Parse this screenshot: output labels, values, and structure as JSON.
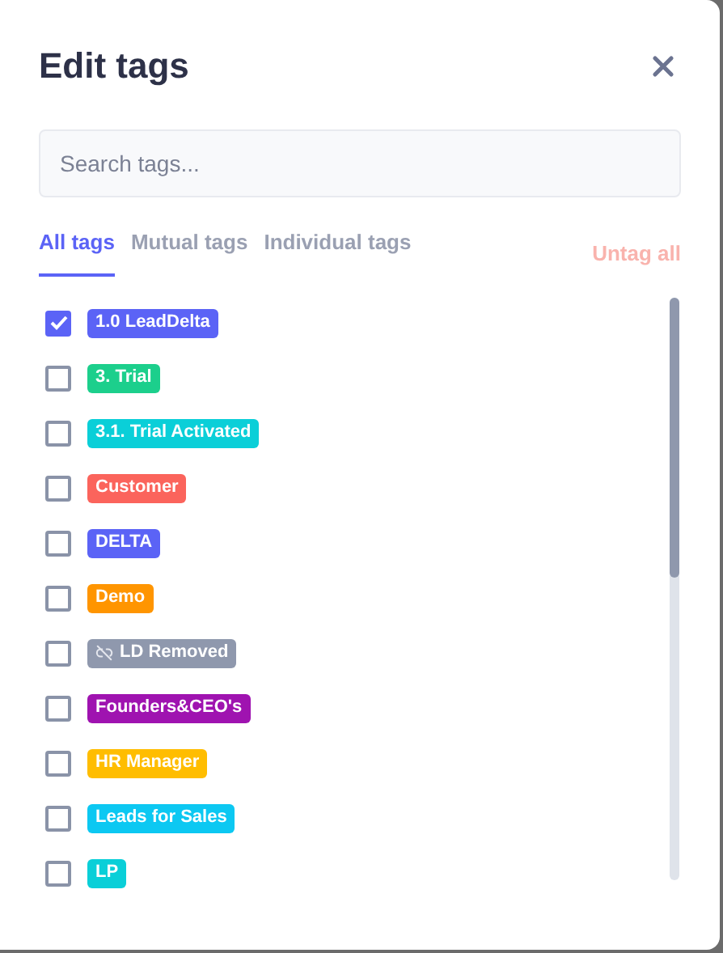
{
  "dialog": {
    "title": "Edit tags"
  },
  "search": {
    "placeholder": "Search tags..."
  },
  "tabs": [
    {
      "label": "All tags",
      "selected": true
    },
    {
      "label": "Mutual tags",
      "selected": false
    },
    {
      "label": "Individual tags",
      "selected": false
    }
  ],
  "untag_all": "Untag all",
  "tags": [
    {
      "label": "1.0 LeadDelta",
      "checked": true,
      "color": "#5b63f6",
      "kind": "plain"
    },
    {
      "label": "3. Trial",
      "checked": false,
      "color": "#1ccf8c",
      "kind": "plain"
    },
    {
      "label": "3.1. Trial Activated",
      "checked": false,
      "color": "#0acfd8",
      "kind": "plain"
    },
    {
      "label": "Customer",
      "checked": false,
      "color": "#fb645c",
      "kind": "plain"
    },
    {
      "label": "DELTA",
      "checked": false,
      "color": "#5b63f6",
      "kind": "plain"
    },
    {
      "label": "Demo",
      "checked": false,
      "color": "#ff9500",
      "kind": "plain"
    },
    {
      "label": "LD Removed",
      "checked": false,
      "color": "#8f98ad",
      "kind": "unlinked"
    },
    {
      "label": "Founders&CEO's",
      "checked": false,
      "color": "#9f13b0",
      "kind": "plain"
    },
    {
      "label": "HR Manager",
      "checked": false,
      "color": "#ffbd00",
      "kind": "plain"
    },
    {
      "label": "Leads for Sales",
      "checked": false,
      "color": "#0cc8f2",
      "kind": "plain"
    },
    {
      "label": "LP",
      "checked": false,
      "color": "#0acfd8",
      "kind": "plain"
    }
  ]
}
